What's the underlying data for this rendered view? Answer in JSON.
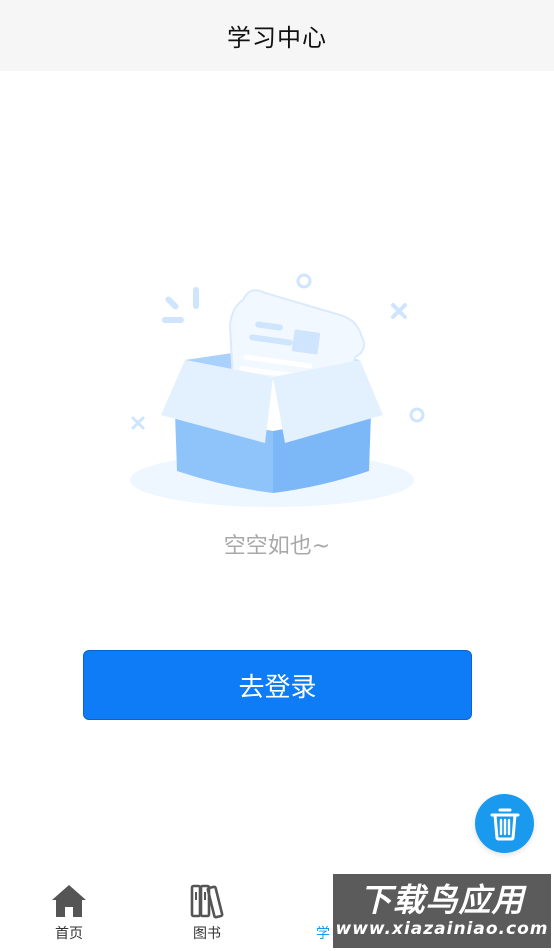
{
  "header": {
    "title": "学习中心"
  },
  "empty_state": {
    "message": "空空如也~",
    "illustration": "empty-box-icon"
  },
  "login_button": {
    "label": "去登录"
  },
  "fab": {
    "icon": "trash-icon"
  },
  "tabbar": {
    "items": [
      {
        "label": "首页",
        "icon": "home-icon",
        "active": false
      },
      {
        "label": "图书",
        "icon": "books-icon",
        "active": false
      },
      {
        "label": "学",
        "icon": "study-icon",
        "active": true
      },
      {
        "label": "",
        "icon": "user-icon",
        "active": false
      }
    ]
  },
  "watermark": {
    "title": "下载鸟应用",
    "url": "www.xiazainiao.com"
  },
  "colors": {
    "primary": "#0d7cf6",
    "tab_active": "#1a9aef",
    "header_bg": "#f6f6f6",
    "muted_text": "#a9a9a9"
  }
}
